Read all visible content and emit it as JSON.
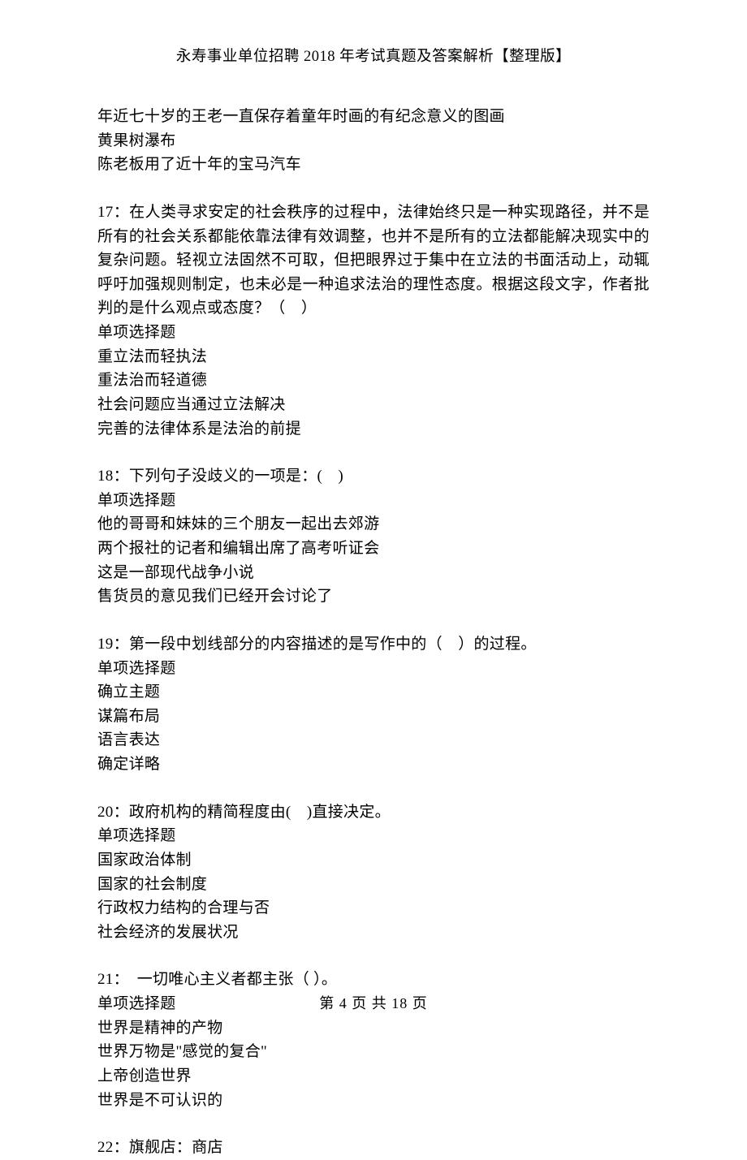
{
  "header": "永寿事业单位招聘 2018 年考试真题及答案解析【整理版】",
  "footer": "第 4 页 共 18 页",
  "blocks": [
    {
      "lines": [
        "年近七十岁的王老一直保存着童年时画的有纪念意义的图画",
        "黄果树瀑布",
        "陈老板用了近十年的宝马汽车"
      ]
    },
    {
      "lines": [
        "17：在人类寻求安定的社会秩序的过程中，法律始终只是一种实现路径，并不是所有的社会关系都能依靠法律有效调整，也并不是所有的立法都能解决现实中的复杂问题。轻视立法固然不可取，但把眼界过于集中在立法的书面活动上，动辄呼吁加强规则制定，也未必是一种追求法治的理性态度。根据这段文字，作者批判的是什么观点或态度？（　）",
        "单项选择题",
        "重立法而轻执法",
        "重法治而轻道德",
        "社会问题应当通过立法解决",
        "完善的法律体系是法治的前提"
      ]
    },
    {
      "lines": [
        "18：下列句子没歧义的一项是：(　)",
        "单项选择题",
        "他的哥哥和妹妹的三个朋友一起出去郊游",
        "两个报社的记者和编辑出席了高考听证会",
        "这是一部现代战争小说",
        "售货员的意见我们已经开会讨论了"
      ]
    },
    {
      "lines": [
        "19：第一段中划线部分的内容描述的是写作中的（　）的过程。",
        "单项选择题",
        "确立主题",
        "谋篇布局",
        "语言表达",
        "确定详略"
      ]
    },
    {
      "lines": [
        "20：政府机构的精简程度由(　)直接决定。",
        "单项选择题",
        "国家政治体制",
        "国家的社会制度",
        "行政权力结构的合理与否",
        "社会经济的发展状况"
      ]
    },
    {
      "lines": [
        "21：　一切唯心主义者都主张（ ）。",
        "单项选择题",
        "世界是精神的产物",
        "世界万物是\"感觉的复合\"",
        "上帝创造世界",
        "世界是不可认识的"
      ]
    },
    {
      "lines": [
        "22：旗舰店：商店"
      ]
    }
  ]
}
